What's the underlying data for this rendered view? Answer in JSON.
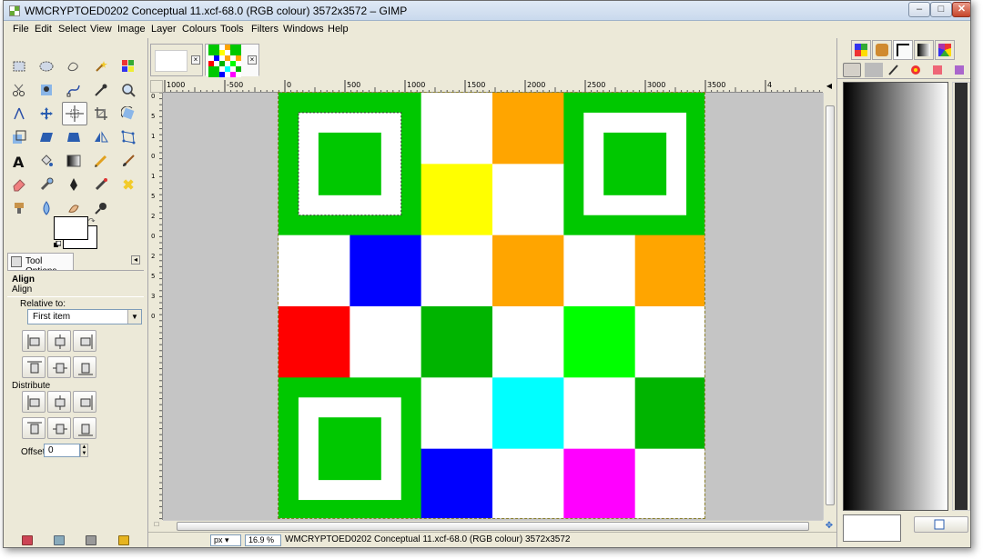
{
  "window": {
    "title": "WMCRYPTOED0202 Conceptual 11.xcf-68.0 (RGB colour) 3572x3572 – GIMP",
    "buttons": [
      "–",
      "□",
      "✕"
    ]
  },
  "menubar": {
    "items": [
      "File",
      "Edit",
      "Select",
      "View",
      "Image",
      "Layer",
      "Colours",
      "Tools",
      "Filters",
      "Windows",
      "Help"
    ]
  },
  "toolbox": {
    "tools": [
      "rect-select",
      "ellipse-select",
      "free-select",
      "fuzzy-select",
      "select-by-color",
      "scissors-select",
      "foreground-select",
      "paths",
      "color-picker",
      "zoom",
      "measure",
      "move",
      "align",
      "crop",
      "rotate",
      "scale",
      "shear",
      "perspective",
      "flip",
      "cage-transform",
      "text",
      "bucket-fill",
      "blend",
      "pencil",
      "paintbrush",
      "eraser",
      "airbrush",
      "ink",
      "mypaint-brush",
      "clone",
      "heal",
      "perspective-clone",
      "blur-sharpen",
      "smudge",
      "dodge-burn"
    ],
    "active_tool": "align",
    "tool_options": {
      "tab_label": "Tool Options",
      "title": "Align",
      "subtitle": "Align",
      "relative_label": "Relative to:",
      "relative_value": "First item",
      "distribute_label": "Distribute",
      "offset_label": "Offset:",
      "offset_value": "0"
    }
  },
  "image_window": {
    "tabs": [
      {
        "name": "blank-image"
      },
      {
        "name": "qr-image",
        "active": true
      }
    ],
    "hruler_ticks": [
      "1000",
      "-500",
      "0",
      "500",
      "1000",
      "1500",
      "2000",
      "2500",
      "3000",
      "3500",
      "4"
    ],
    "vruler_ticks": [
      "0",
      "5",
      "1",
      "0",
      "1",
      "5",
      "2",
      "0",
      "2",
      "5",
      "3",
      "0"
    ],
    "grid": [
      [
        "#00c800",
        "#00c800",
        "#ffffff",
        "#ffa500",
        "#00c800",
        "#00c800"
      ],
      [
        "#00c800",
        "#00c800",
        "#ffff00",
        "#ffffff",
        "#00c800",
        "#00c800"
      ],
      [
        "#ffffff",
        "#0000ff",
        "#ffffff",
        "#ffa500",
        "#ffffff",
        "#ffa500"
      ],
      [
        "#ff0000",
        "#ffffff",
        "#00b400",
        "#ffffff",
        "#00ff00",
        "#ffffff"
      ],
      [
        "#00c800",
        "#00c800",
        "#ffffff",
        "#00ffff",
        "#ffffff",
        "#00b400"
      ],
      [
        "#00c800",
        "#00c800",
        "#0000ff",
        "#ffffff",
        "#ff00ff",
        "#ffffff"
      ]
    ],
    "finder_colors": {
      "outer": "#00c800",
      "inner_white": "#ffffff",
      "center": "#00c800"
    },
    "status": {
      "unit": "px",
      "zoom": "16.9 %",
      "text": "WMCRYPTOED0202 Conceptual 11.xcf-68.0 (RGB colour) 3572x3572"
    }
  },
  "right_dock": {
    "tabs": [
      "patterns",
      "brushes-tab",
      "paths-tab",
      "gradients",
      "palettes"
    ],
    "subtabs": [
      "layers",
      "channels",
      "paths",
      "palette",
      "colors",
      "undo",
      "extra"
    ]
  },
  "colors": {
    "window_bg": "#ece9d8",
    "titlebar": "#dfe9f5",
    "canvas_bg": "#c5c5c5",
    "selection": "#8a7f2b"
  }
}
